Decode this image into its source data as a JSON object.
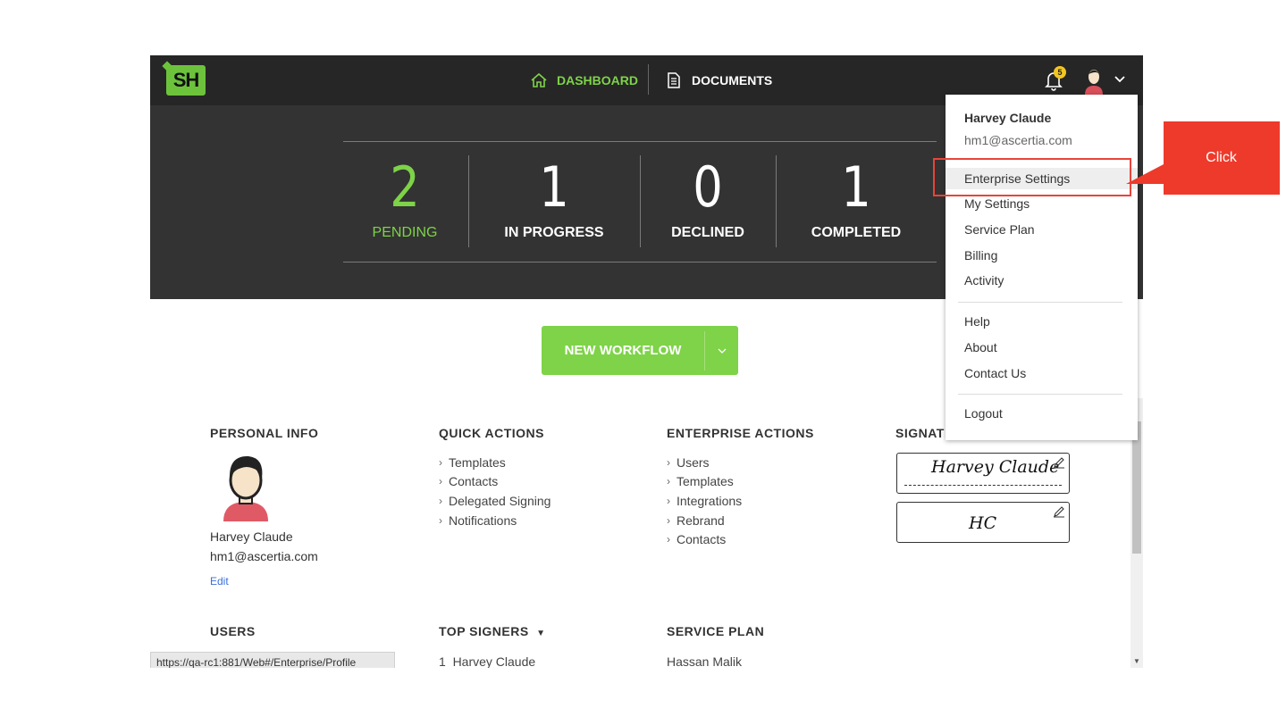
{
  "app": {
    "logo": "SH"
  },
  "nav": {
    "dashboard": "DASHBOARD",
    "documents": "DOCUMENTS"
  },
  "notifications": {
    "count": "5"
  },
  "stats": [
    {
      "value": "2",
      "label": "PENDING"
    },
    {
      "value": "1",
      "label": "IN PROGRESS"
    },
    {
      "value": "0",
      "label": "DECLINED"
    },
    {
      "value": "1",
      "label": "COMPLETED"
    }
  ],
  "new_workflow": {
    "label": "NEW WORKFLOW"
  },
  "personal_info": {
    "title": "PERSONAL INFO",
    "name": "Harvey Claude",
    "email": "hm1@ascertia.com",
    "edit": "Edit"
  },
  "quick_actions": {
    "title": "QUICK ACTIONS",
    "items": [
      "Templates",
      "Contacts",
      "Delegated Signing",
      "Notifications"
    ]
  },
  "enterprise_actions": {
    "title": "ENTERPRISE ACTIONS",
    "items": [
      "Users",
      "Templates",
      "Integrations",
      "Rebrand",
      "Contacts"
    ]
  },
  "signatures": {
    "title": "SIGNAT",
    "sig1": "Harvey Claude",
    "sig2": "HC"
  },
  "users": {
    "title": "USERS"
  },
  "top_signers": {
    "title": "TOP SIGNERS",
    "first": "1  Harvey Claude"
  },
  "service_plan": {
    "title": "SERVICE PLAN",
    "first": "Hassan Malik"
  },
  "status_url": "https://qa-rc1:881/Web#/Enterprise/Profile",
  "user_menu": {
    "name": "Harvey Claude",
    "email": "hm1@ascertia.com",
    "items_group1": [
      "Enterprise Settings",
      "My Settings",
      "Service Plan",
      "Billing",
      "Activity"
    ],
    "items_group2": [
      "Help",
      "About",
      "Contact Us"
    ],
    "items_group3": [
      "Logout"
    ]
  },
  "annotation": {
    "label": "Click",
    "color": "#ee3a2b"
  },
  "colors": {
    "accent": "#7ed348",
    "header_bg": "#262626",
    "hero_bg": "#333333"
  }
}
